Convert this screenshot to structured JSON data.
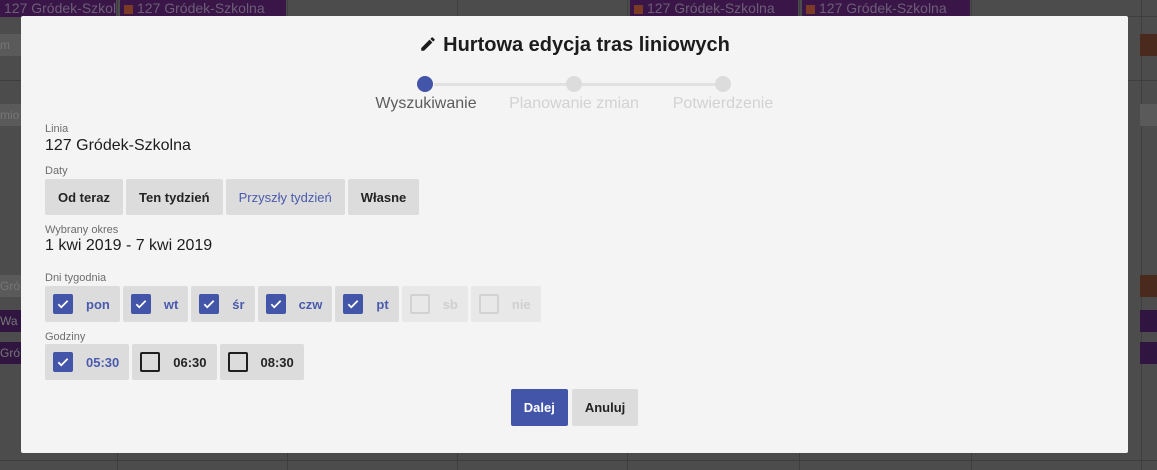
{
  "background": {
    "events": [
      "127 Gródek-Szkolna",
      "127 Gródek-Szkolna",
      "127 Gródek-Szkolna",
      "127 Gródek-Szkolna"
    ],
    "left_chips": [
      "m",
      "mio",
      "Gró",
      "Wa",
      "Gró"
    ]
  },
  "modal": {
    "title": "Hurtowa edycja tras liniowych",
    "title_icon": "pencil-icon",
    "steps": [
      {
        "label": "Wyszukiwanie",
        "active": true
      },
      {
        "label": "Planowanie zmian",
        "active": false
      },
      {
        "label": "Potwierdzenie",
        "active": false
      }
    ],
    "line": {
      "label": "Linia",
      "value": "127 Gródek-Szkolna"
    },
    "dates": {
      "label": "Daty",
      "options": [
        {
          "label": "Od teraz",
          "active": false
        },
        {
          "label": "Ten tydzień",
          "active": false
        },
        {
          "label": "Przyszły tydzień",
          "active": true
        },
        {
          "label": "Własne",
          "active": false
        }
      ]
    },
    "period": {
      "label": "Wybrany okres",
      "value": "1 kwi 2019 - 7 kwi 2019"
    },
    "weekdays": {
      "label": "Dni tygodnia",
      "items": [
        {
          "label": "pon",
          "checked": true,
          "disabled": false
        },
        {
          "label": "wt",
          "checked": true,
          "disabled": false
        },
        {
          "label": "śr",
          "checked": true,
          "disabled": false
        },
        {
          "label": "czw",
          "checked": true,
          "disabled": false
        },
        {
          "label": "pt",
          "checked": true,
          "disabled": false
        },
        {
          "label": "sb",
          "checked": false,
          "disabled": true
        },
        {
          "label": "nie",
          "checked": false,
          "disabled": true
        }
      ]
    },
    "hours": {
      "label": "Godziny",
      "items": [
        {
          "label": "05:30",
          "checked": true
        },
        {
          "label": "06:30",
          "checked": false
        },
        {
          "label": "08:30",
          "checked": false
        }
      ]
    },
    "next_label": "Dalej",
    "cancel_label": "Anuluj"
  },
  "colors": {
    "accent": "#4355a9",
    "modal_bg": "#f4f4f4",
    "chip_bg": "#dcdcdc"
  }
}
